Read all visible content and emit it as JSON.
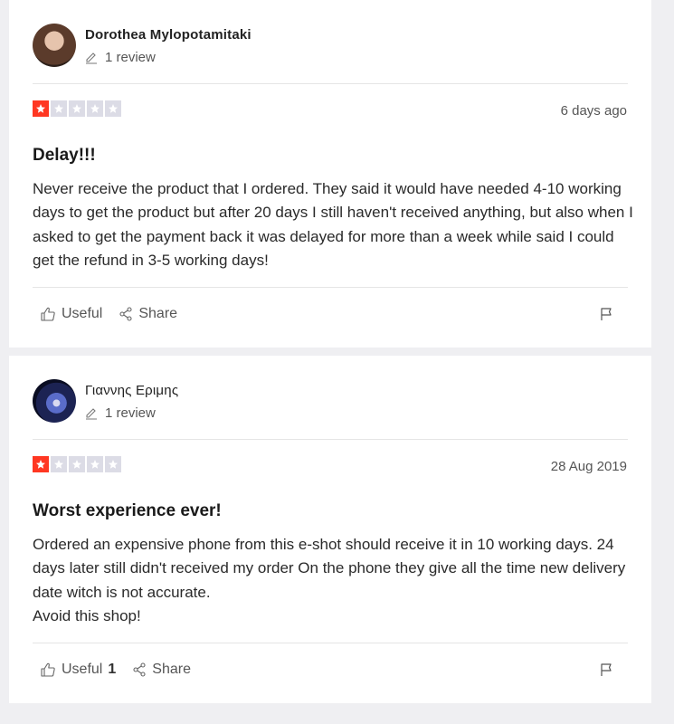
{
  "reviews": [
    {
      "name": "Dorothea Mylopotamitaki",
      "review_count": "1 review",
      "rating": 1,
      "date": "6 days ago",
      "title": "Delay!!!",
      "body": "Never receive the product that I ordered. They said it would have needed 4-10 working days to get the product but after 20 days I still haven't received anything, but also when I asked to get the payment back it was delayed for more than a week while said I could get the refund in 3-5 working days!",
      "useful_label": "Useful",
      "useful_count": "",
      "share_label": "Share"
    },
    {
      "name": "Γιαννης Εριμης",
      "review_count": "1 review",
      "rating": 1,
      "date": "28 Aug 2019",
      "title": "Worst experience ever!",
      "body_lines": [
        "Ordered an expensive phone from this e-shot should receive it in 10 working days. 24 days later still didn't received my order On the phone they give all the time new delivery date witch is not accurate.",
        "Avoid this shop!"
      ],
      "useful_label": "Useful",
      "useful_count": "1",
      "share_label": "Share"
    }
  ],
  "colors": {
    "star_active": "#ff3722",
    "star_inactive": "#dcdce6",
    "page_background": "#efeff2"
  },
  "icons": [
    "pencil-icon",
    "star-icon",
    "thumbs-up-icon",
    "share-icon",
    "flag-icon"
  ]
}
